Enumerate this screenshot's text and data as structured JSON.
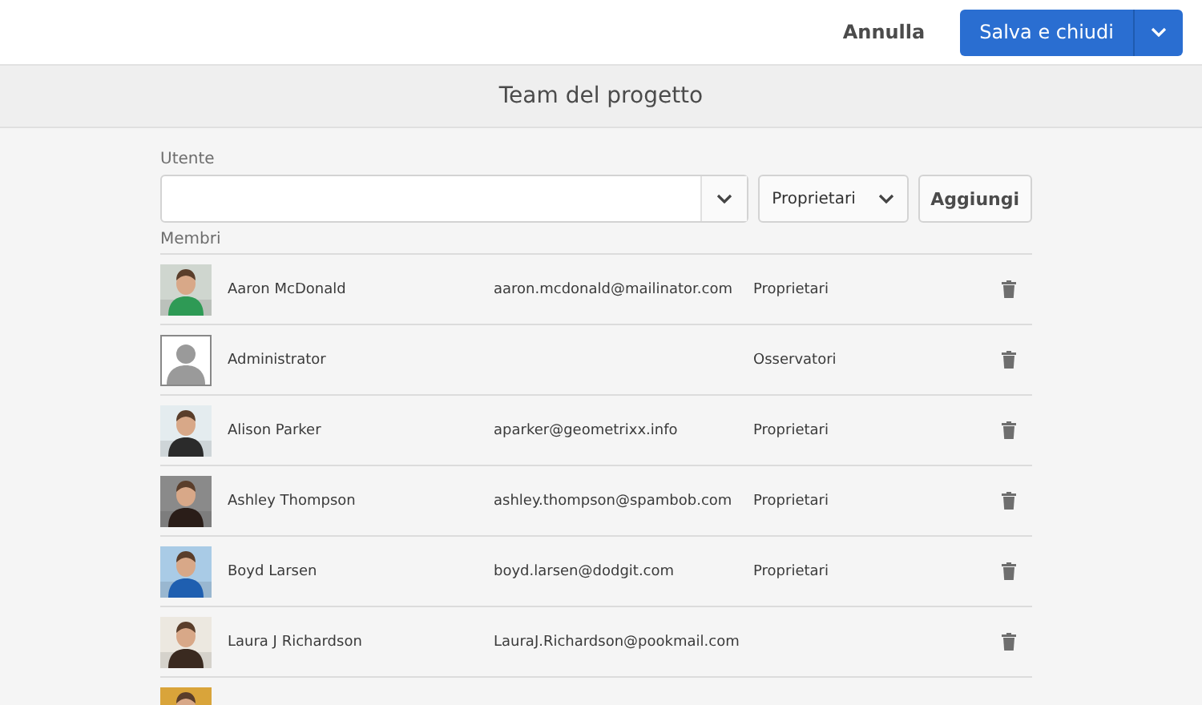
{
  "header": {
    "cancel": "Annulla",
    "save": "Salva e chiudi"
  },
  "title": "Team del progetto",
  "user_field": {
    "label": "Utente"
  },
  "role_select": {
    "value": "Proprietari"
  },
  "add_button": "Aggiungi",
  "members_label": "Membri",
  "members": [
    {
      "kind": "picture",
      "name": "Aaron McDonald",
      "email": "aaron.mcdonald@mailinator.com",
      "role": "Proprietari"
    },
    {
      "kind": "placeholder",
      "name": "Administrator",
      "role": "Osservatori"
    },
    {
      "kind": "picture",
      "name": "Alison Parker",
      "email": "aparker@geometrixx.info",
      "role": "Proprietari"
    },
    {
      "kind": "picture",
      "name": "Ashley Thompson",
      "email": "ashley.thompson@spambob.com",
      "role": "Proprietari"
    },
    {
      "kind": "picture",
      "name": "Boyd Larsen",
      "email": "boyd.larsen@dodgit.com",
      "role": "Proprietari"
    },
    {
      "kind": "picture",
      "name": "Laura J Richardson",
      "email": "LauraJ.Richardson@pookmail.com"
    },
    {
      "kind": "picture"
    }
  ]
}
